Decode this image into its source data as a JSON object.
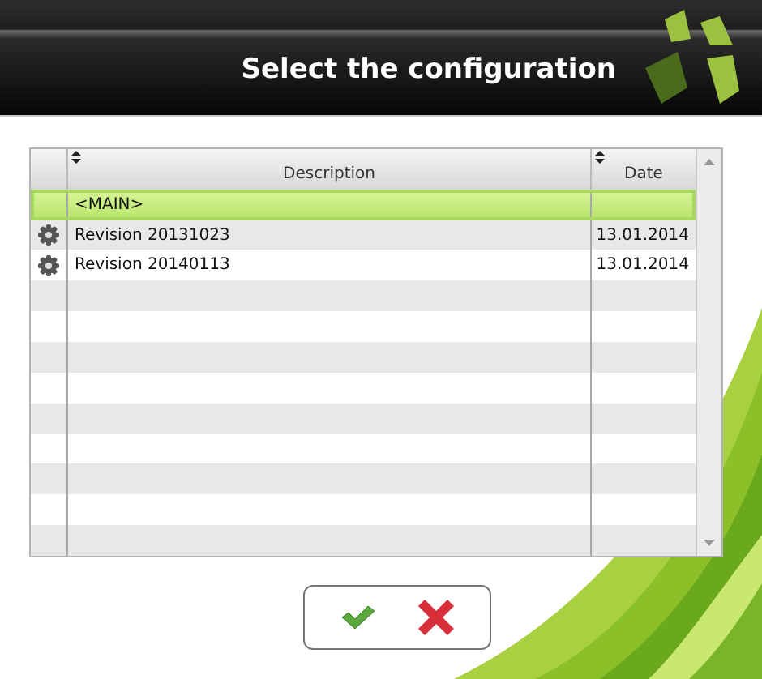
{
  "header": {
    "title": "Select the configuration"
  },
  "table": {
    "columns": [
      {
        "label": "Description",
        "sortable": true
      },
      {
        "label": "Date",
        "sortable": true
      }
    ],
    "rows": [
      {
        "kind": "main",
        "description": "<MAIN>",
        "date": "",
        "selected": true
      },
      {
        "kind": "revision",
        "description": "Revision 20131023",
        "date": "13.01.2014",
        "selected": false
      },
      {
        "kind": "revision",
        "description": "Revision 20140113",
        "date": "13.01.2014",
        "selected": false
      }
    ]
  },
  "buttons": [
    {
      "kind": "confirm"
    },
    {
      "kind": "cancel"
    }
  ]
}
